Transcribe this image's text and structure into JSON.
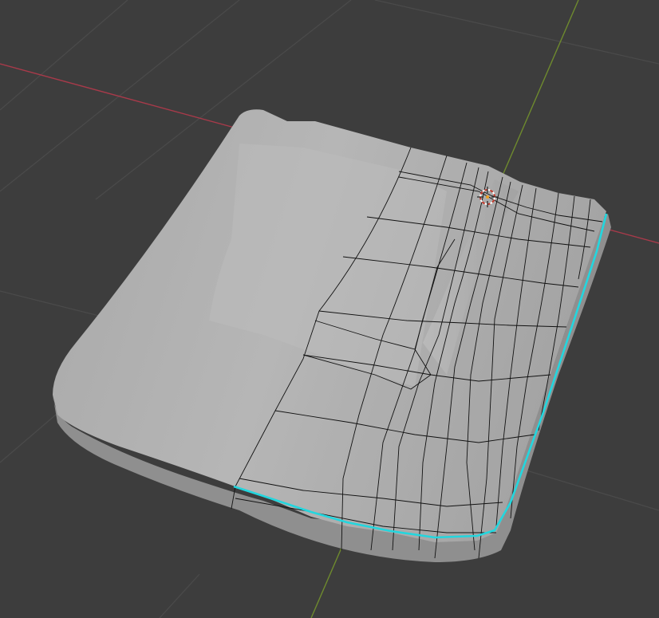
{
  "viewport": {
    "background": "#3d3d3d",
    "grid_color": "#4a4a4a",
    "x_axis_color": "#a83a4a",
    "y_axis_color": "#6e8a2e"
  },
  "object": {
    "surface_color": "#b2b2b2",
    "wire_color": "#111111",
    "selected_edge_color": "#23d6de",
    "mirror_modifier_visible": true
  },
  "origin_marker": {
    "icon": "3d-cursor-icon",
    "ring_colors": [
      "#c0392b",
      "#ffffff"
    ]
  }
}
